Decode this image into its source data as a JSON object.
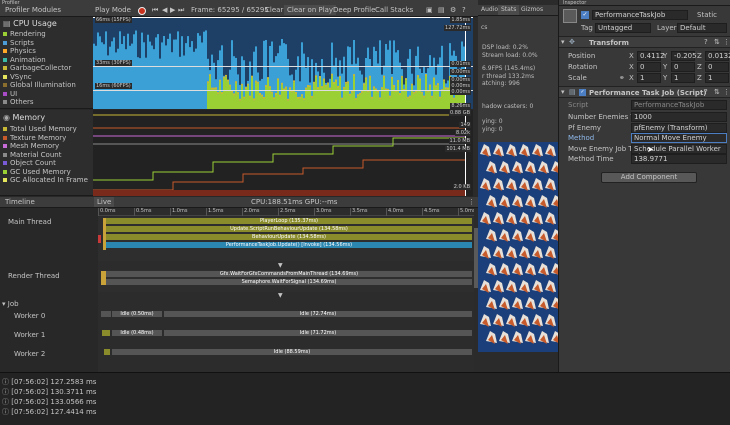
{
  "profiler": {
    "window_title": "Profiler",
    "modules_label": "Profiler Modules",
    "play_mode": "Play Mode",
    "frame_label": "Frame: 65295 / 65295",
    "clear": "Clear",
    "clear_on_play": "Clear on Play",
    "deep_profile": "Deep Profile",
    "call_stacks": "Call Stacks"
  },
  "cpu": {
    "title": "CPU Usage",
    "categories": [
      {
        "label": "Rendering",
        "color": "#9bd035"
      },
      {
        "label": "Scripts",
        "color": "#4a9bd6"
      },
      {
        "label": "Physics",
        "color": "#ffa726"
      },
      {
        "label": "Animation",
        "color": "#39b9a8"
      },
      {
        "label": "GarbageCollector",
        "color": "#c7b836"
      },
      {
        "label": "VSync",
        "color": "#e6e65c"
      },
      {
        "label": "Global Illumination",
        "color": "#8a6e2e"
      },
      {
        "label": "UI",
        "color": "#aa4bc8"
      },
      {
        "label": "Others",
        "color": "#8a8a8a"
      }
    ],
    "marker_15fps": "66ms (15FPS)",
    "marker_30fps": "33ms (30FPS)",
    "marker_60fps": "16ms (60FPS)",
    "right_values": [
      "1.85ms",
      "127.72ms",
      "0.01ms",
      "0.00ms",
      "0.00ms",
      "0.00ms",
      "0.00ms",
      "8.26ms"
    ]
  },
  "memory": {
    "title": "Memory",
    "categories": [
      {
        "label": "Total Used Memory",
        "color": "#c7b836"
      },
      {
        "label": "Texture Memory",
        "color": "#c75a2b"
      },
      {
        "label": "Mesh Memory",
        "color": "#c76bd6"
      },
      {
        "label": "Material Count",
        "color": "#8a8a8a"
      },
      {
        "label": "Object Count",
        "color": "#7a5bd6"
      },
      {
        "label": "GC Used Memory",
        "color": "#9bd035"
      },
      {
        "label": "GC Allocated In Frame",
        "color": "#e6e65c"
      }
    ],
    "right_values": [
      "0.88 GB",
      "149",
      "8.02k",
      "11.0 MB",
      "101.4 MB",
      "2.0 KB"
    ]
  },
  "timeline": {
    "label": "Timeline",
    "live": "Live",
    "cpu_gpu": "CPU:188.51ms   GPU:--ms",
    "ticks": [
      "0.0ms",
      "0.5ms",
      "1.0ms",
      "1.5ms",
      "2.0ms",
      "2.5ms",
      "3.0ms",
      "3.5ms",
      "4.0ms",
      "4.5ms",
      "5.0ms"
    ],
    "main_thread": "Main Thread",
    "render_thread": "Render Thread",
    "job": "Job",
    "workers": [
      "Worker 0",
      "Worker 1",
      "Worker 2"
    ],
    "main_bars": [
      "PlayerLoop (135.37ms)",
      "Update.ScriptRunBehaviourUpdate (134.58ms)",
      "BehaviourUpdate (134.58ms)",
      "PerformanceTaskJob.Update() [Invoke] (134.56ms)"
    ],
    "render_bars": [
      "Gfx.WaitForGfxCommandsFromMainThread (134.69ms)",
      "Semaphore.WaitForSignal (134.69ms)"
    ],
    "w0_idle_a": "Idle (0.50ms)",
    "w0_idle_b": "Idle (72.74ms)",
    "w1_idle_a": "Idle (0.48ms)",
    "w1_idle_b": "Idle (71.72ms)",
    "w2_idle": "Idle (88.59ms)"
  },
  "console": {
    "logs": [
      "[07:56:02] 127.2583 ms",
      "[07:56:02] 130.3711 ms",
      "[07:56:02] 133.0566 ms",
      "[07:56:02] 127.4414 ms"
    ]
  },
  "game": {
    "tabs": [
      "Audio",
      "Stats",
      "Gizmos"
    ],
    "stats": [
      "DSP load: 0.2%",
      "Stream load: 0.0%",
      "6.9FPS (145.4ms)",
      "r thread 133.2ms",
      "atching: 996",
      "hadow casters: 0",
      "ying: 0",
      "ying: 0"
    ],
    "stats_prefix": "cs"
  },
  "inspector": {
    "title": "Inspector",
    "object_name": "PerformanceTaskJob",
    "static": "Static",
    "tag_label": "Tag",
    "tag_value": "Untagged",
    "layer_label": "Layer",
    "layer_value": "Default",
    "transform": {
      "title": "Transform",
      "rows": [
        {
          "label": "Position",
          "x": "0.4112",
          "y": "-0.205",
          "z": "0.0132"
        },
        {
          "label": "Rotation",
          "x": "0",
          "y": "0",
          "z": "0"
        },
        {
          "label": "Scale",
          "x": "1",
          "y": "1",
          "z": "1"
        }
      ]
    },
    "script_comp": {
      "title": "Performance Task Job (Script)",
      "script_label": "Script",
      "script_value": "PerformanceTaskJob",
      "num_label": "Number Enemies To C",
      "num_value": "1000",
      "pf_label": "Pf Enemy",
      "pf_value": "pfEnemy (Transform)",
      "method_label": "Method",
      "method_value": "Normal Move Enemy",
      "move_label": "Move Enemy Job Typ",
      "move_value": "Schedule Parallel Worker Thr",
      "time_label": "Method Time",
      "time_value": "138.9771"
    },
    "add_component": "Add Component"
  }
}
